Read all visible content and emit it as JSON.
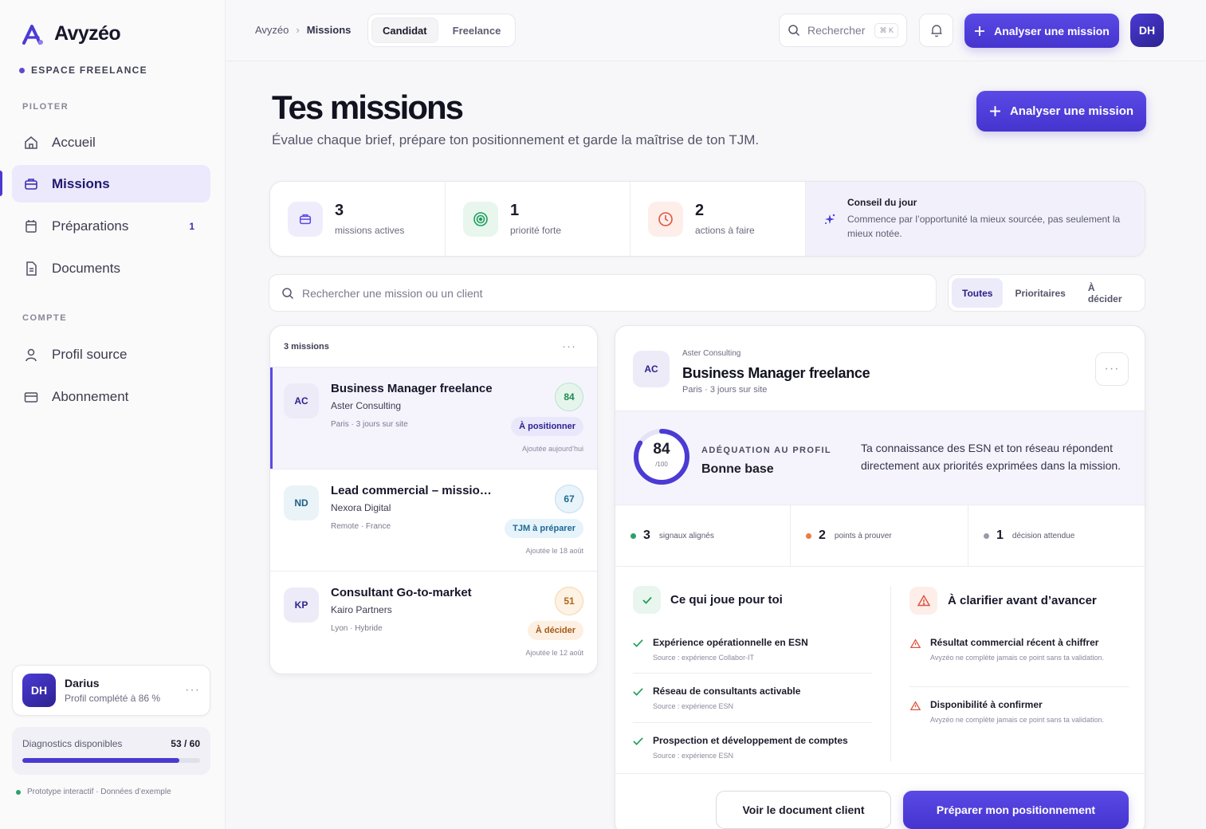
{
  "sidebar": {
    "brand": "Avyzéo",
    "space_label": "ESPACE FREELANCE",
    "section_pilot": "PILOTER",
    "section_account": "COMPTE",
    "nav": [
      {
        "label": "Accueil",
        "icon": "home-icon"
      },
      {
        "label": "Missions",
        "icon": "briefcase-icon",
        "active": true
      },
      {
        "label": "Préparations",
        "icon": "calendar-icon",
        "count": "1"
      },
      {
        "label": "Documents",
        "icon": "document-icon"
      }
    ],
    "account_nav": [
      {
        "label": "Profil source",
        "icon": "user-icon"
      },
      {
        "label": "Abonnement",
        "icon": "card-icon"
      }
    ],
    "user": {
      "initials": "DH",
      "name": "Darius",
      "profile": "Profil complété à 86 %"
    },
    "diagnostics": {
      "label": "Diagnostics disponibles",
      "value": "53 / 60",
      "progress_fraction": 0.883
    },
    "prototype_note": "Prototype interactif · Données d’exemple"
  },
  "topbar": {
    "breadcrumb_root": "Avyzéo",
    "breadcrumb_current": "Missions",
    "modes": [
      "Candidat",
      "Freelance"
    ],
    "active_mode": "Candidat",
    "search_placeholder": "Rechercher",
    "search_shortcut": "⌘ K",
    "cta": "Analyser une mission",
    "avatar": "DH"
  },
  "header": {
    "title": "Tes missions",
    "subtitle": "Évalue chaque brief, prépare ton positionnement et garde la maîtrise de ton TJM.",
    "cta": "Analyser une mission"
  },
  "stats": [
    {
      "value": "3",
      "label": "missions actives",
      "icon": "briefcase-icon",
      "color": "#5b49e6"
    },
    {
      "value": "1",
      "label": "priorité forte",
      "icon": "target-icon",
      "color": "#1f9d5c"
    },
    {
      "value": "2",
      "label": "actions à faire",
      "icon": "clock-icon",
      "color": "#e0553f"
    }
  ],
  "tip": {
    "title": "Conseil du jour",
    "text": "Commence par l’opportunité la mieux sourcée, pas seulement la mieux notée."
  },
  "mission_search": {
    "placeholder": "Rechercher une mission ou un client"
  },
  "filters": [
    "Toutes",
    "Prioritaires",
    "À décider"
  ],
  "active_filter": "Toutes",
  "list": {
    "count_label": "3 missions",
    "items": [
      {
        "initials": "AC",
        "title": "Business Manager freelance",
        "company": "Aster Consulting",
        "location": "Paris · 3 jours sur site",
        "score": "84",
        "tag": "À positionner",
        "added": "Ajoutée aujourd’hui"
      },
      {
        "initials": "ND",
        "title": "Lead commercial – mission ...",
        "company": "Nexora Digital",
        "location": "Remote · France",
        "score": "67",
        "tag": "TJM à préparer",
        "added": "Ajoutée le 18 août"
      },
      {
        "initials": "KP",
        "title": "Consultant Go-to-market",
        "company": "Kairo Partners",
        "location": "Lyon · Hybride",
        "score": "51",
        "tag": "À décider",
        "added": "Ajoutée le 12 août"
      }
    ]
  },
  "detail": {
    "initials": "AC",
    "company": "Aster Consulting",
    "title": "Business Manager freelance",
    "location": "Paris · 3 jours sur site",
    "fit": {
      "score": "84",
      "denominator": "/100",
      "score_fraction": 0.84,
      "label": "ADÉQUATION AU PROFIL",
      "value": "Bonne base",
      "text": "Ta connaissance des ESN et ton réseau répondent directement aux priorités exprimées dans la mission."
    },
    "signals": [
      {
        "value": "3",
        "label": "signaux alignés",
        "color": "#2ca06a"
      },
      {
        "value": "2",
        "label": "points à prouver",
        "color": "#f07a3e"
      },
      {
        "value": "1",
        "label": "décision attendue",
        "color": "#9a9aac"
      }
    ],
    "strengths": {
      "title": "Ce qui joue pour toi",
      "items": [
        {
          "title": "Expérience opérationnelle en ESN",
          "source": "Source : expérience Collabor-IT"
        },
        {
          "title": "Réseau de consultants activable",
          "source": "Source : expérience ESN"
        },
        {
          "title": "Prospection et développement de comptes",
          "source": "Source : expérience ESN"
        }
      ]
    },
    "clarify": {
      "title": "À clarifier avant d’avancer",
      "items": [
        {
          "title": "Résultat commercial récent à chiffrer",
          "note": "Avyzéo ne complète jamais ce point sans ta validation."
        },
        {
          "title": "Disponibilité à confirmer",
          "note": "Avyzéo ne complète jamais ce point sans ta validation."
        }
      ]
    },
    "btn_document": "Voir le document client",
    "btn_prepare": "Préparer mon positionnement"
  }
}
